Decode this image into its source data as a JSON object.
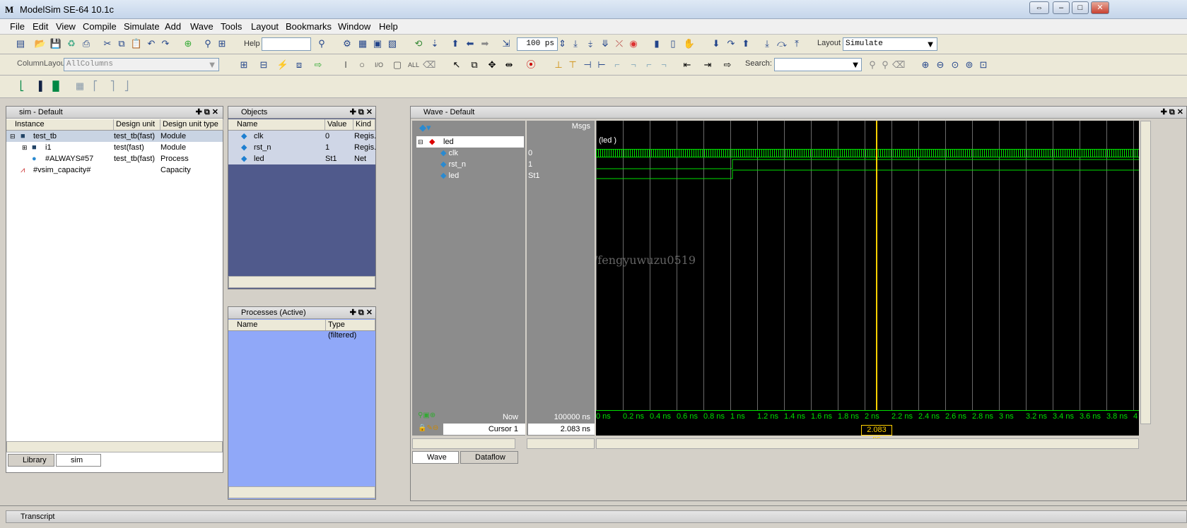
{
  "window": {
    "title": "ModelSim SE-64 10.1c",
    "icon_letter": "M"
  },
  "menu": [
    "File",
    "Edit",
    "View",
    "Compile",
    "Simulate",
    "Add",
    "Wave",
    "Tools",
    "Layout",
    "Bookmarks",
    "Window",
    "Help"
  ],
  "toolbar": {
    "help_label": "Help",
    "help_value": "",
    "run_length": "100 ps",
    "layout_label": "Layout",
    "layout_value": "Simulate",
    "column_layout_label": "ColumnLayout",
    "column_layout_value": "AllColumns",
    "search_label": "Search:",
    "search_value": ""
  },
  "sim_panel": {
    "title": "sim - Default",
    "columns": [
      "Instance",
      "Design unit",
      "Design unit type"
    ],
    "rows": [
      {
        "instance": "test_tb",
        "unit": "test_tb(fast)",
        "type": "Module"
      },
      {
        "instance": "i1",
        "unit": "test(fast)",
        "type": "Module"
      },
      {
        "instance": "#ALWAYS#57",
        "unit": "test_tb(fast)",
        "type": "Process"
      },
      {
        "instance": "#vsim_capacity#",
        "unit": "",
        "type": "Capacity"
      }
    ],
    "tabs": [
      "Library",
      "sim"
    ]
  },
  "objects_panel": {
    "title": "Objects",
    "columns": [
      "Name",
      "Value",
      "Kind"
    ],
    "rows": [
      {
        "name": "clk",
        "value": "0",
        "kind": "Regis."
      },
      {
        "name": "rst_n",
        "value": "1",
        "kind": "Regis."
      },
      {
        "name": "led",
        "value": "St1",
        "kind": "Net"
      }
    ]
  },
  "processes_panel": {
    "title": "Processes (Active)",
    "columns": [
      "Name",
      "Type (filtered)"
    ]
  },
  "wave_panel": {
    "title": "Wave - Default",
    "msgs_label": "Msgs",
    "group": "led",
    "group_label": "(led )",
    "signals": [
      {
        "name": "clk",
        "value": "0"
      },
      {
        "name": "rst_n",
        "value": "1"
      },
      {
        "name": "led",
        "value": "St1"
      }
    ],
    "now_label": "Now",
    "now_value": "100000 ns",
    "cursor_label": "Cursor 1",
    "cursor_value": "2.083 ns",
    "cursor_marker": "2.083 ns",
    "time_ticks": [
      "0 ns",
      "0.2 ns",
      "0.4 ns",
      "0.6 ns",
      "0.8 ns",
      "1 ns",
      "1.2 ns",
      "1.4 ns",
      "1.6 ns",
      "1.8 ns",
      "2 ns",
      "2.2 ns",
      "2.4 ns",
      "2.6 ns",
      "2.8 ns",
      "3 ns",
      "3.2 ns",
      "3.4 ns",
      "3.6 ns",
      "3.8 ns",
      "4"
    ],
    "tabs": [
      "Wave",
      "Dataflow"
    ],
    "wave_color": "#00e000",
    "cursor_color": "#ffd000"
  },
  "watermark": "http://blog.csdn.net/fengyuwuzu0519",
  "transcript": {
    "title": "Transcript"
  }
}
